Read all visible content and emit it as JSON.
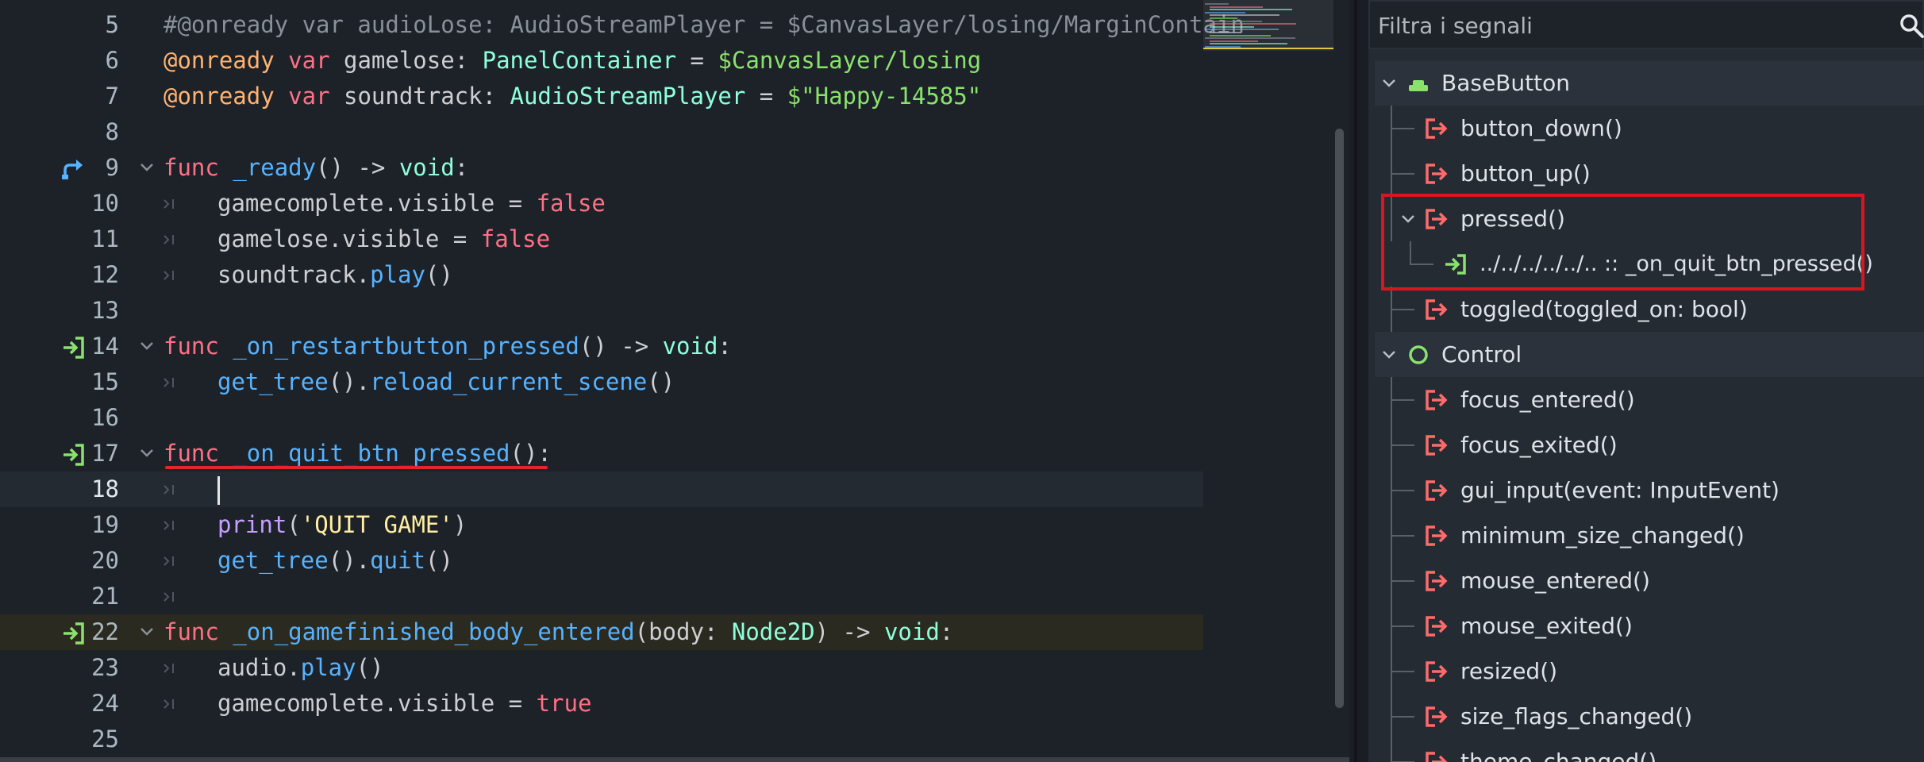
{
  "editor": {
    "lines": [
      {
        "num": "5",
        "tokens": [
          {
            "t": "#@onready var audioLose: AudioStreamPlayer = $CanvasLayer/losing/MarginContain",
            "c": "cmt"
          }
        ]
      },
      {
        "num": "6",
        "tokens": [
          {
            "t": "@onready",
            "c": "ann"
          },
          {
            "t": " var ",
            "c": "kw"
          },
          {
            "t": "gamelose: ",
            "c": ""
          },
          {
            "t": "PanelContainer",
            "c": "typ"
          },
          {
            "t": " = ",
            "c": ""
          },
          {
            "t": "$CanvasLayer/losing",
            "c": "str"
          }
        ]
      },
      {
        "num": "7",
        "tokens": [
          {
            "t": "@onready",
            "c": "ann"
          },
          {
            "t": " var ",
            "c": "kw"
          },
          {
            "t": "soundtrack: ",
            "c": ""
          },
          {
            "t": "AudioStreamPlayer",
            "c": "typ"
          },
          {
            "t": " = ",
            "c": ""
          },
          {
            "t": "$\"Happy-14585\"",
            "c": "str"
          }
        ]
      },
      {
        "num": "8",
        "tokens": []
      },
      {
        "num": "9",
        "fold": true,
        "icon": "override",
        "tokens": [
          {
            "t": "func ",
            "c": "kw"
          },
          {
            "t": "_ready",
            "c": "fn"
          },
          {
            "t": "() -> ",
            "c": ""
          },
          {
            "t": "void",
            "c": "typ"
          },
          {
            "t": ":",
            "c": ""
          }
        ]
      },
      {
        "num": "10",
        "indent": 1,
        "tokens": [
          {
            "t": "gamecomplete.visible = ",
            "c": ""
          },
          {
            "t": "false",
            "c": "kw"
          }
        ]
      },
      {
        "num": "11",
        "indent": 1,
        "tokens": [
          {
            "t": "gamelose.visible = ",
            "c": ""
          },
          {
            "t": "false",
            "c": "kw"
          }
        ]
      },
      {
        "num": "12",
        "indent": 1,
        "tokens": [
          {
            "t": "soundtrack.",
            "c": ""
          },
          {
            "t": "play",
            "c": "meth"
          },
          {
            "t": "()",
            "c": ""
          }
        ]
      },
      {
        "num": "13",
        "tokens": []
      },
      {
        "num": "14",
        "fold": true,
        "icon": "connected",
        "tokens": [
          {
            "t": "func ",
            "c": "kw"
          },
          {
            "t": "_on_restartbutton_pressed",
            "c": "fn"
          },
          {
            "t": "() -> ",
            "c": ""
          },
          {
            "t": "void",
            "c": "typ"
          },
          {
            "t": ":",
            "c": ""
          }
        ]
      },
      {
        "num": "15",
        "indent": 1,
        "tokens": [
          {
            "t": "get_tree",
            "c": "meth"
          },
          {
            "t": "().",
            "c": ""
          },
          {
            "t": "reload_current_scene",
            "c": "meth"
          },
          {
            "t": "()",
            "c": ""
          }
        ]
      },
      {
        "num": "16",
        "tokens": []
      },
      {
        "num": "17",
        "fold": true,
        "icon": "connected",
        "tokens": [
          {
            "t": "func ",
            "c": "kw"
          },
          {
            "t": "_on_quit_btn_pressed",
            "c": "fn"
          },
          {
            "t": "():",
            "c": ""
          }
        ]
      },
      {
        "num": "18",
        "indent": 1,
        "current": true,
        "caret": true,
        "tokens": []
      },
      {
        "num": "19",
        "indent": 1,
        "tokens": [
          {
            "t": "print",
            "c": "bi"
          },
          {
            "t": "(",
            "c": ""
          },
          {
            "t": "'QUIT GAME'",
            "c": "str2"
          },
          {
            "t": ")",
            "c": ""
          }
        ]
      },
      {
        "num": "20",
        "indent": 1,
        "tokens": [
          {
            "t": "get_tree",
            "c": "meth"
          },
          {
            "t": "().",
            "c": ""
          },
          {
            "t": "quit",
            "c": "meth"
          },
          {
            "t": "()",
            "c": ""
          }
        ]
      },
      {
        "num": "21",
        "indent": 0,
        "guide": true,
        "tokens": []
      },
      {
        "num": "22",
        "fold": true,
        "icon": "connected",
        "exec": true,
        "tokens": [
          {
            "t": "func ",
            "c": "kw"
          },
          {
            "t": "_on_gamefinished_body_entered",
            "c": "fn"
          },
          {
            "t": "(body: ",
            "c": ""
          },
          {
            "t": "Node2D",
            "c": "typ"
          },
          {
            "t": ") -> ",
            "c": ""
          },
          {
            "t": "void",
            "c": "typ"
          },
          {
            "t": ":",
            "c": ""
          }
        ]
      },
      {
        "num": "23",
        "indent": 1,
        "tokens": [
          {
            "t": "audio.",
            "c": ""
          },
          {
            "t": "play",
            "c": "meth"
          },
          {
            "t": "()",
            "c": ""
          }
        ]
      },
      {
        "num": "24",
        "indent": 1,
        "tokens": [
          {
            "t": "gamecomplete.visible = ",
            "c": ""
          },
          {
            "t": "true",
            "c": "kw"
          }
        ]
      },
      {
        "num": "25",
        "tokens": []
      }
    ]
  },
  "signals": {
    "filter_placeholder": "Filtra i segnali",
    "tree": [
      {
        "kind": "class",
        "label": "BaseButton",
        "icon": "base-button-icon"
      },
      {
        "kind": "signal",
        "label": "button_down()"
      },
      {
        "kind": "signal",
        "label": "button_up()"
      },
      {
        "kind": "signal",
        "label": "pressed()",
        "expanded": true
      },
      {
        "kind": "connection",
        "label": "../../../../../.. :: _on_quit_btn_pressed()"
      },
      {
        "kind": "signal",
        "label": "toggled(toggled_on: bool)"
      },
      {
        "kind": "class",
        "label": "Control",
        "icon": "control-icon"
      },
      {
        "kind": "signal",
        "label": "focus_entered()"
      },
      {
        "kind": "signal",
        "label": "focus_exited()"
      },
      {
        "kind": "signal",
        "label": "gui_input(event: InputEvent)"
      },
      {
        "kind": "signal",
        "label": "minimum_size_changed()"
      },
      {
        "kind": "signal",
        "label": "mouse_entered()"
      },
      {
        "kind": "signal",
        "label": "mouse_exited()"
      },
      {
        "kind": "signal",
        "label": "resized()"
      },
      {
        "kind": "signal",
        "label": "size_flags_changed()"
      },
      {
        "kind": "signal",
        "label": "theme_changed()"
      }
    ]
  },
  "colors": {
    "signal": "#ff6b6b",
    "connected": "#8ae26c",
    "override": "#57b3ff",
    "highlight": "#d9161f"
  }
}
